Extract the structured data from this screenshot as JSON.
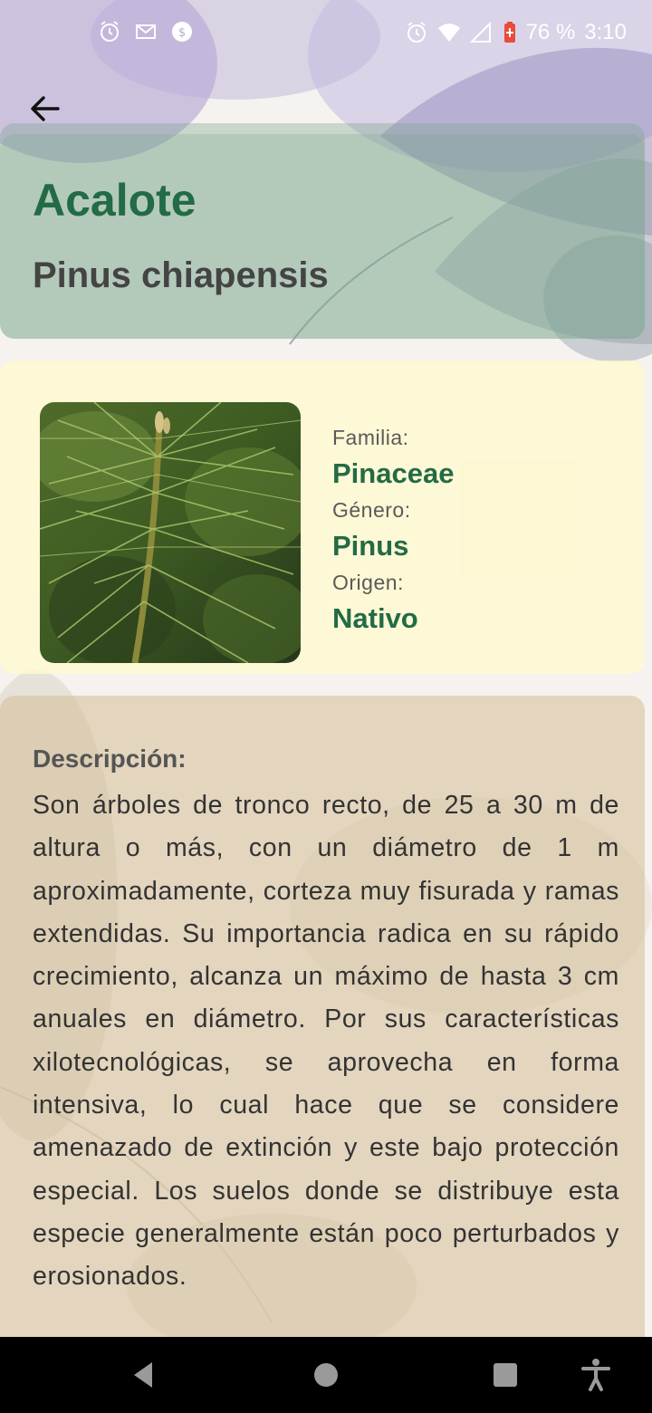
{
  "status_bar": {
    "time": "3:10",
    "battery": "76 %",
    "icons_left": [
      "alarm-icon",
      "gmail-icon",
      "app-icon"
    ],
    "icons_right": [
      "alarm-icon",
      "wifi-icon",
      "signal-icon",
      "battery-icon"
    ]
  },
  "header": {
    "common_name": "Acalote",
    "scientific_name": "Pinus chiapensis"
  },
  "info": {
    "familia_label": "Familia:",
    "familia_value": "Pinaceae",
    "genero_label": "Género:",
    "genero_value": "Pinus",
    "origen_label": "Origen:",
    "origen_value": "Nativo"
  },
  "description": {
    "label": "Descripción:",
    "text": "Son árboles de tronco recto, de 25 a 30 m de altura o más, con un diámetro de 1 m aproximadamente, corteza muy fisurada y ramas extendidas. Su importancia radica en su rápido crecimiento, alcanza un máximo de hasta 3 cm anuales en diámetro. Por sus características xilotecnológicas, se aprovecha en forma intensiva, lo cual hace que se considere amenazado de extinción y este bajo protección especial. Los suelos donde se distribuye esta especie generalmente están poco perturbados y erosionados."
  },
  "colors": {
    "accent_green": "#236b45",
    "header_card": "#76a48c",
    "info_card": "#fffacd",
    "desc_card": "#d4be96"
  }
}
